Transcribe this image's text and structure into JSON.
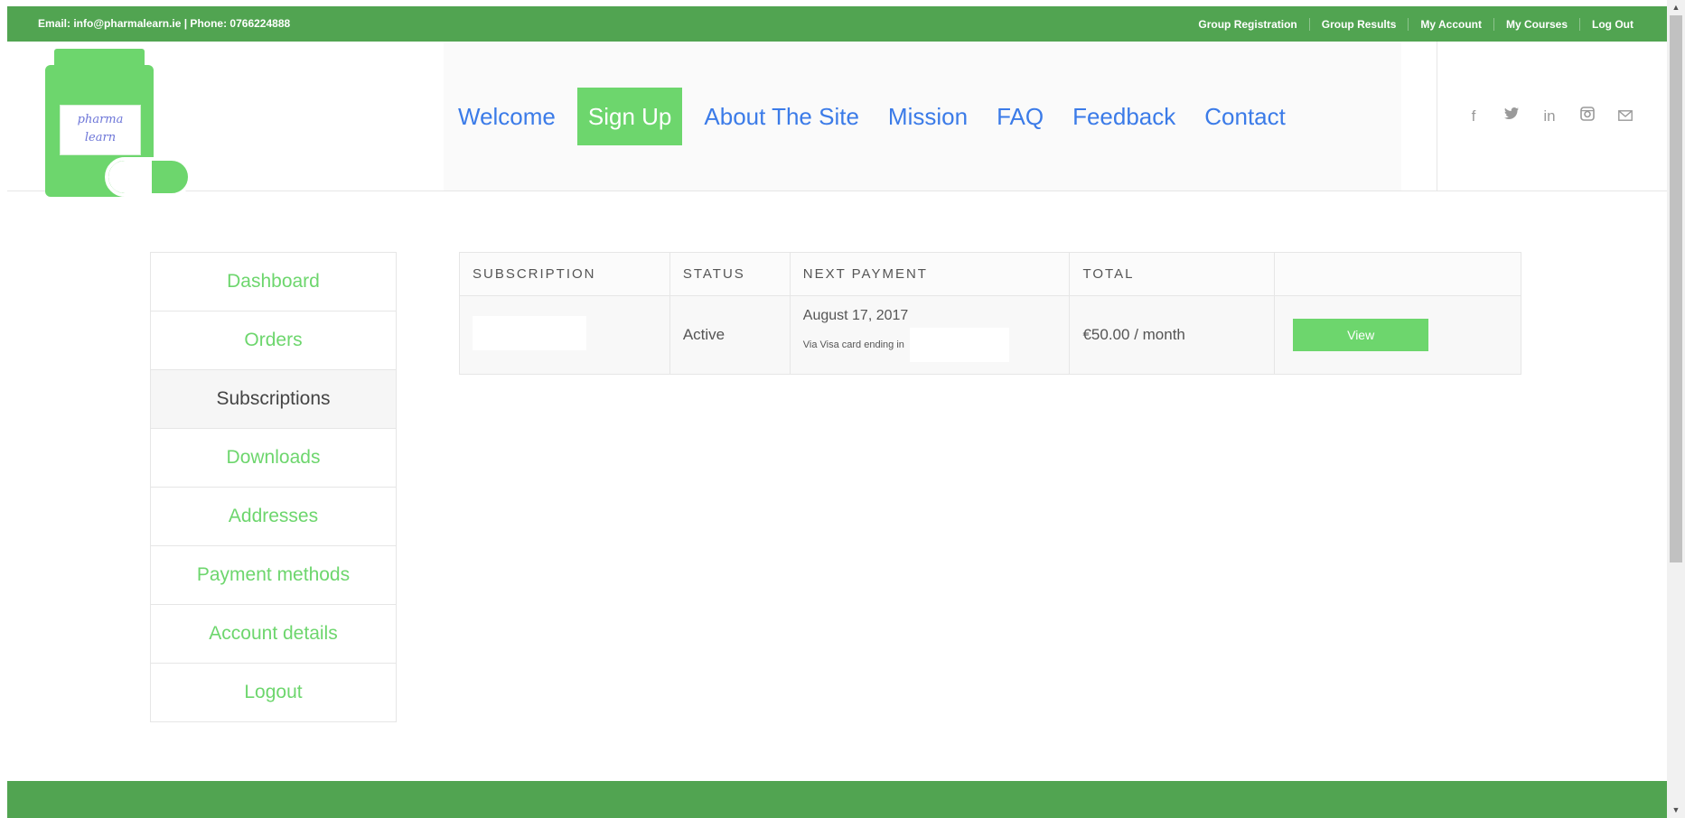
{
  "topbar": {
    "contact": "Email: info@pharmalearn.ie | Phone: 0766224888",
    "links": [
      "Group Registration",
      "Group Results",
      "My Account",
      "My Courses",
      "Log Out"
    ]
  },
  "logo": {
    "line1": "pharma",
    "line2": "learn"
  },
  "nav": {
    "items": [
      "Welcome",
      "Sign Up",
      "About The Site",
      "Mission",
      "FAQ",
      "Feedback",
      "Contact"
    ]
  },
  "social": {
    "icons": [
      "facebook-icon",
      "twitter-icon",
      "linkedin-icon",
      "instagram-icon",
      "mail-icon"
    ],
    "glyphs": [
      "f",
      "🐦",
      "in",
      "◙",
      "✉"
    ]
  },
  "account_nav": {
    "items": [
      "Dashboard",
      "Orders",
      "Subscriptions",
      "Downloads",
      "Addresses",
      "Payment methods",
      "Account details",
      "Logout"
    ],
    "active": "Subscriptions"
  },
  "subscriptions": {
    "headers": [
      "SUBSCRIPTION",
      "STATUS",
      "NEXT PAYMENT",
      "TOTAL",
      ""
    ],
    "rows": [
      {
        "subscription": "",
        "status": "Active",
        "next_payment_date": "August 17, 2017",
        "next_payment_method": "Via Visa card ending in",
        "total": "€50.00 / month",
        "action": "View"
      }
    ]
  },
  "colors": {
    "brand_green": "#51a451",
    "accent_green": "#6dd66d",
    "nav_blue": "#3b7be8"
  }
}
